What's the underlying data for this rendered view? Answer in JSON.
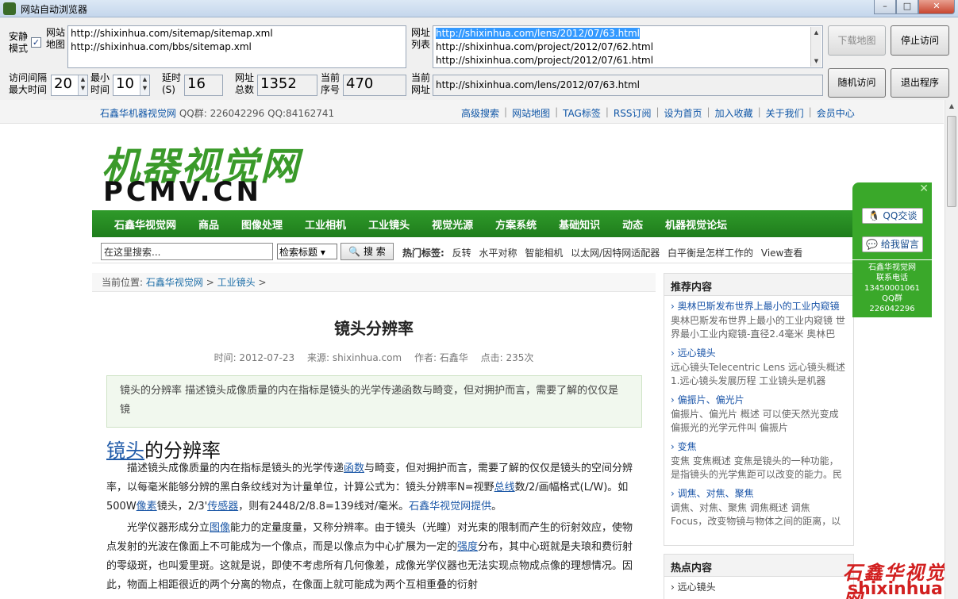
{
  "window": {
    "title": "网站自动浏览器",
    "min": "–",
    "max": "□",
    "close": "✕"
  },
  "controls": {
    "safe_mode_label_1": "安静",
    "safe_mode_label_2": "模式",
    "safe_mode_checked": "✓",
    "sitemap_label_1": "网站",
    "sitemap_label_2": "地图",
    "sitemap_lines": [
      "http://shixinhua.com/sitemap/sitemap.xml",
      "http://shixinhua.com/bbs/sitemap.xml"
    ],
    "urllist_label_1": "网址",
    "urllist_label_2": "列表",
    "urllist_lines": [
      "http://shixinhua.com/lens/2012/07/63.html",
      "http://shixinhua.com/project/2012/07/62.html",
      "http://shixinhua.com/project/2012/07/61.html"
    ],
    "interval_label_1": "访问间隔",
    "interval_label_2": "最大时间",
    "interval_max": "20",
    "min_label_1": "最小",
    "min_label_2": "时间",
    "interval_min": "10",
    "delay_label_1": "延时",
    "delay_label_2": "(S)",
    "delay": "16",
    "total_label_1": "网址",
    "total_label_2": "总数",
    "total": "1352",
    "current_idx_label_1": "当前",
    "current_idx_label_2": "序号",
    "current_idx": "470",
    "current_url_label_1": "当前",
    "current_url_label_2": "网址",
    "current_url": "http://shixinhua.com/lens/2012/07/63.html",
    "btn_download_map": "下载地图",
    "btn_stop": "停止访问",
    "btn_random": "随机访问",
    "btn_exit": "退出程序"
  },
  "site": {
    "brand": "石鑫华机器视觉网",
    "qq_group": "QQ群: 226042296 QQ:84162741",
    "toplinks": [
      "高级搜索",
      "网站地图",
      "TAG标签",
      "RSS订阅",
      "设为首页",
      "加入收藏",
      "关于我们",
      "会员中心"
    ],
    "logo_cn": "机器视觉网",
    "logo_en": "PCMV.CN",
    "nav": [
      "石鑫华视觉网",
      "商品",
      "图像处理",
      "工业相机",
      "工业镜头",
      "视觉光源",
      "方案系统",
      "基础知识",
      "动态",
      "机器视觉论坛"
    ],
    "search_placeholder": "在这里搜索...",
    "search_select": "检索标题 ▾",
    "search_button": "🔍 搜 索",
    "hot_label": "热门标签:",
    "hot_tags": [
      "反转",
      "水平对称",
      "智能相机",
      "以太网/因特网适配器",
      "白平衡是怎样工作的",
      "View查看"
    ],
    "crumb_prefix": "当前位置:",
    "crumb_home": "石鑫华视觉网",
    "crumb_sep": ">",
    "crumb_cat": "工业镜头",
    "crumb_end": ">"
  },
  "article": {
    "title": "镜头分辨率",
    "meta_time": "时间: 2012-07-23",
    "meta_source": "来源: shixinhua.com",
    "meta_author": "作者: 石鑫华",
    "meta_clicks": "点击: 235次",
    "summary": "镜头的分辨率 描述镜头成像质量的内在指标是镜头的光学传递函数与畸变，但对拥护而言，需要了解的仅仅是镜",
    "h2_link": "镜头",
    "h2_rest": "的分辨率",
    "p1_a": "描述镜头成像质量的内在指标是镜头的光学传递",
    "p1_l1": "函数",
    "p1_b": "与畸变，但对拥护而言，需要了解的仅仅是镜头的空间分辨率，以每毫米能够分辨的黑白条纹线对为计量单位，计算公式为：镜头分辨率N=视野",
    "p1_l2": "总线",
    "p1_c": "数/2/画幅格式(L/W)。如500W",
    "p1_l3": "像素",
    "p1_d": "镜头，2/3'",
    "p1_l4": "传感器",
    "p1_e": "，则有2448/2/8.8=139线对/毫米。",
    "p1_l5": "石鑫华视觉网提供",
    "p1_f": "。",
    "p2_a": "光学仪器形成分立",
    "p2_l1": "图像",
    "p2_b": "能力的定量度量，又称分辨率。由于镜头（光瞳）对光束的限制而产生的衍射效应，使物点发射的光波在像面上不可能成为一个像点，而是以像点为中心扩展为一定的",
    "p2_l2": "强度",
    "p2_c": "分布，其中心斑就是夫琅和费衍射的零级斑，也叫爱里斑。这就是说，即使不考虑所有几何像差，成像光学仪器也无法实现点物成点像的理想情况。因此，物面上相距很近的两个分离的物点，在像面上就可能成为两个互相重叠的衍射"
  },
  "sidebar": {
    "rec_title": "推荐内容",
    "rec_items": [
      {
        "t": "奥林巴斯发布世界上最小的工业内窥镜",
        "d": "奥林巴斯发布世界上最小的工业内窥镜 世界最小工业内窥镜-直径2.4毫米 奥林巴"
      },
      {
        "t": "远心镜头",
        "d": "远心镜头Telecentric Lens 远心镜头概述 1.远心镜头发展历程 工业镜头是机器"
      },
      {
        "t": "偏振片、偏光片",
        "d": "偏振片、偏光片 概述 可以使天然光变成偏振光的光学元件叫 偏振片"
      },
      {
        "t": "变焦",
        "d": "变焦 变焦概述 变焦是镜头的一种功能，是指镜头的光学焦距可以改变的能力。民"
      },
      {
        "t": "调焦、对焦、聚焦",
        "d": "调焦、对焦、聚焦 调焦概述 调焦 Focus，改变物镜与物体之间的距离，以"
      }
    ],
    "hot_title": "热点内容",
    "hot_items": [
      "远心镜头"
    ]
  },
  "qq": {
    "close": "✕",
    "chat": "🐧 QQ交谈",
    "msg": "💬 给我留言",
    "info_1": "石鑫华视觉网",
    "info_2": "联系电话",
    "info_3": "13450001061",
    "info_4": "QQ群",
    "info_5": "226042296"
  },
  "watermark": {
    "cn": "石鑫华视觉网",
    "en": "shixinhua.com"
  }
}
